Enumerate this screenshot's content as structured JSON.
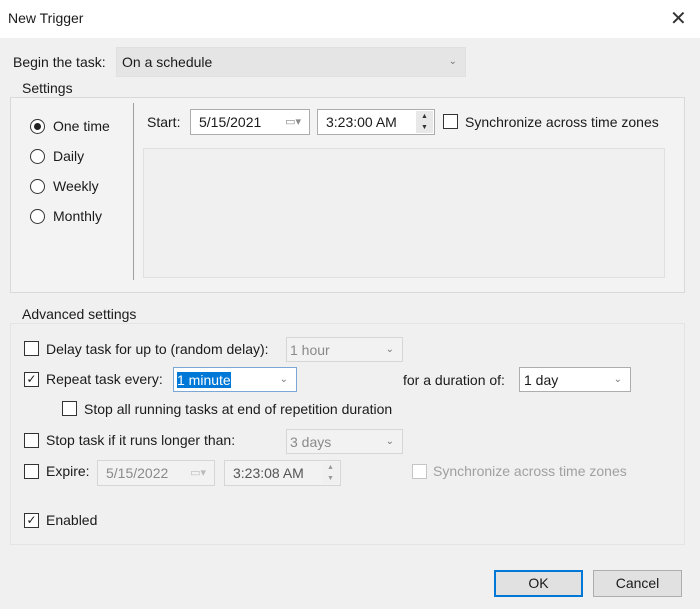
{
  "window": {
    "title": "New Trigger",
    "close_icon": "close-icon"
  },
  "begin": {
    "label": "Begin the task:",
    "value": "On a schedule"
  },
  "settings": {
    "label": "Settings",
    "options": [
      {
        "label": "One time",
        "selected": true
      },
      {
        "label": "Daily",
        "selected": false
      },
      {
        "label": "Weekly",
        "selected": false
      },
      {
        "label": "Monthly",
        "selected": false
      }
    ],
    "start_label": "Start:",
    "start_date": "5/15/2021",
    "start_time": "3:23:00 AM",
    "sync_label": "Synchronize across time zones",
    "sync_checked": false
  },
  "advanced": {
    "label": "Advanced settings",
    "delay": {
      "label": "Delay task for up to (random delay):",
      "checked": false,
      "value": "1 hour"
    },
    "repeat": {
      "label": "Repeat task every:",
      "checked": true,
      "value": "1 minute",
      "duration_label": "for a duration of:",
      "duration_value": "1 day"
    },
    "stop_all": {
      "label": "Stop all running tasks at end of repetition duration",
      "checked": false
    },
    "stop_task": {
      "label": "Stop task if it runs longer than:",
      "checked": false,
      "value": "3 days"
    },
    "expire": {
      "label": "Expire:",
      "checked": false,
      "date": "5/15/2022",
      "time": "3:23:08 AM",
      "sync_label": "Synchronize across time zones"
    },
    "enabled": {
      "label": "Enabled",
      "checked": true
    }
  },
  "buttons": {
    "ok": "OK",
    "cancel": "Cancel"
  },
  "colors": {
    "accent": "#0078d7"
  }
}
